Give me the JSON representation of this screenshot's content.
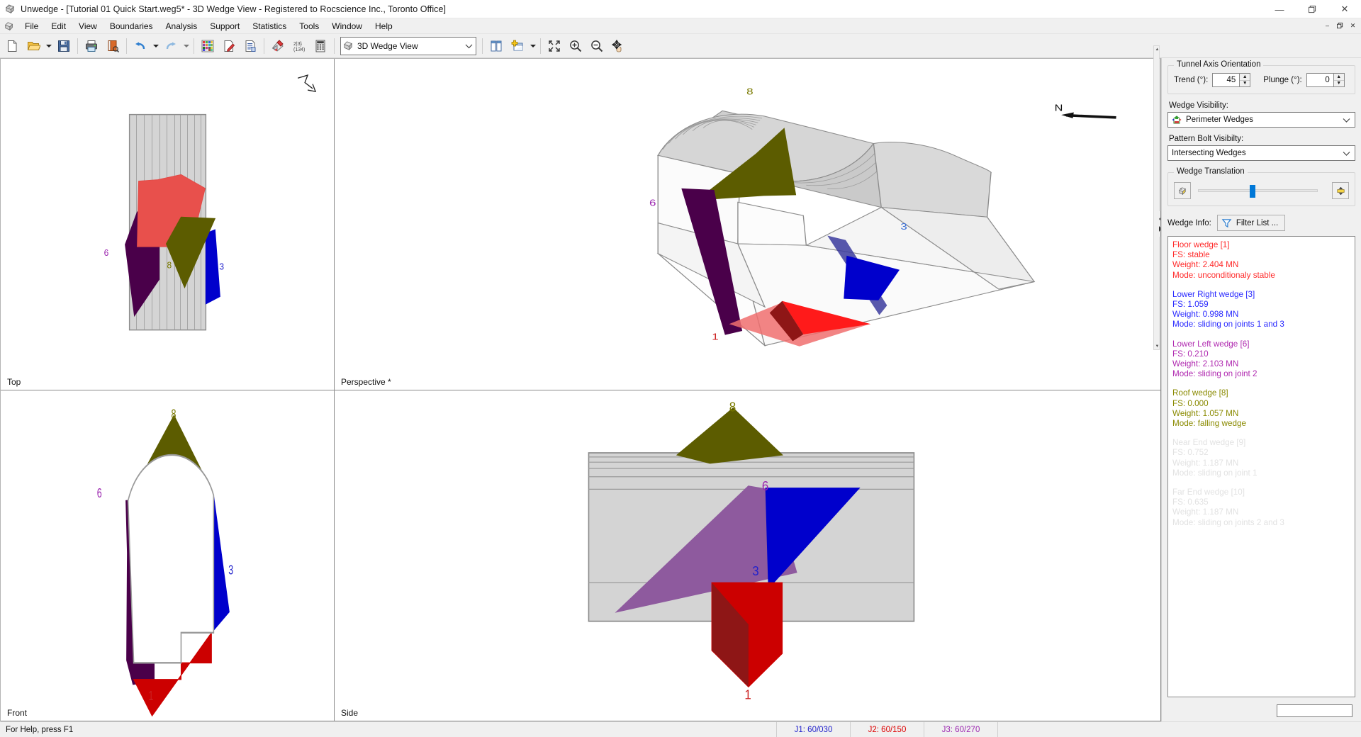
{
  "window": {
    "title": "Unwedge - [Tutorial 01 Quick Start.weg5* - 3D Wedge View - Registered to Rocscience Inc., Toronto Office]",
    "app_icon": "unwedge-icon",
    "minimize_label": "—",
    "maximize_label": "❐",
    "close_label": "✕",
    "mdi_restore_label": "–",
    "mdi_maximize_label": "❐",
    "mdi_close_label": "✕"
  },
  "menubar": {
    "icon": "document-icon",
    "items": [
      {
        "label": "File"
      },
      {
        "label": "Edit"
      },
      {
        "label": "View"
      },
      {
        "label": "Boundaries"
      },
      {
        "label": "Analysis"
      },
      {
        "label": "Support"
      },
      {
        "label": "Statistics"
      },
      {
        "label": "Tools"
      },
      {
        "label": "Window"
      },
      {
        "label": "Help"
      }
    ]
  },
  "toolbar": {
    "buttons": [
      {
        "name": "new-file-icon",
        "tip": "New"
      },
      {
        "name": "open-folder-icon",
        "tip": "Open"
      },
      {
        "name": "open-dropdown-arrow-icon",
        "tip": "Open recent"
      },
      {
        "name": "save-icon",
        "tip": "Save"
      },
      {
        "name": "print-icon",
        "tip": "Print"
      },
      {
        "name": "print-preview-icon",
        "tip": "Print Preview"
      },
      {
        "name": "undo-icon",
        "tip": "Undo"
      },
      {
        "name": "undo-dropdown-arrow-icon",
        "tip": "Undo history"
      },
      {
        "name": "redo-icon",
        "tip": "Redo"
      },
      {
        "name": "redo-dropdown-arrow-icon",
        "tip": "Redo history"
      },
      {
        "name": "color-palette-icon",
        "tip": "Display Options"
      },
      {
        "name": "page-pencil-icon",
        "tip": "Edit Properties"
      },
      {
        "name": "report-icon",
        "tip": "Info Viewer"
      },
      {
        "name": "joint-properties-icon",
        "tip": "Joint Properties"
      },
      {
        "name": "statistics-icon",
        "tip": "Statistics"
      },
      {
        "name": "grid-calculator-icon",
        "tip": "Compute"
      }
    ],
    "view_combo": {
      "value": "3D Wedge View",
      "icon": "wedge-view-icon",
      "caret": "∨"
    },
    "right_buttons": [
      {
        "name": "tile-vertical-icon",
        "tip": "Tile Vertically"
      },
      {
        "name": "add-view-icon",
        "tip": "Add View"
      },
      {
        "name": "add-view-dropdown-arrow-icon",
        "tip": "Add View menu"
      },
      {
        "name": "zoom-all-icon",
        "tip": "Zoom All"
      },
      {
        "name": "zoom-in-icon",
        "tip": "Zoom In"
      },
      {
        "name": "zoom-out-icon",
        "tip": "Zoom Out"
      },
      {
        "name": "pan-icon",
        "tip": "Pan"
      }
    ]
  },
  "viewports": [
    {
      "id": "top",
      "label": "Top",
      "compass_icon": "north-arrow-icon"
    },
    {
      "id": "perspective",
      "label": "Perspective *",
      "compass_icon": "north-arrow-icon",
      "compass_label": "N"
    },
    {
      "id": "front",
      "label": "Front"
    },
    {
      "id": "side",
      "label": "Side"
    }
  ],
  "wedge_labels": {
    "roof": "8",
    "lower_left": "6",
    "lower_right": "3",
    "floor": "1"
  },
  "sidepanel": {
    "tunnel_axis": {
      "title": "Tunnel Axis Orientation",
      "trend_label": "Trend (°):",
      "trend_value": "45",
      "plunge_label": "Plunge (°):",
      "plunge_value": "0",
      "spin_up": "▲",
      "spin_down": "▼"
    },
    "wedge_visibility": {
      "label": "Wedge Visibility:",
      "value": "Perimeter Wedges",
      "icon": "perimeter-wedges-icon",
      "caret": "∨"
    },
    "pattern_bolt_visibility": {
      "label": "Pattern Bolt Visibilty:",
      "value": "Intersecting Wedges",
      "caret": "∨"
    },
    "wedge_translation": {
      "title": "Wedge Translation",
      "reset_icon": "wedge-reset-icon",
      "scale_icon": "wedge-scale-icon",
      "slider_percent": 43
    },
    "wedge_info": {
      "label": "Wedge Info:",
      "filter_button": "Filter List ...",
      "filter_icon": "funnel-icon"
    }
  },
  "wedges": [
    {
      "name": "Floor wedge [1]",
      "fs": "FS: stable",
      "weight": "Weight: 2.404 MN",
      "mode": "Mode: unconditionaly stable",
      "color": "#ff0000",
      "dimmed": false
    },
    {
      "name": "Lower Right wedge [3]",
      "fs": "FS: 1.059",
      "weight": "Weight: 0.998 MN",
      "mode": "Mode: sliding on joints 1 and 3",
      "color": "#0000ff",
      "dimmed": false
    },
    {
      "name": "Lower Left wedge [6]",
      "fs": "FS: 0.210",
      "weight": "Weight: 2.103 MN",
      "mode": "Mode: sliding on joint 2",
      "color": "#9c27b0",
      "dimmed": false
    },
    {
      "name": "Roof wedge [8]",
      "fs": "FS: 0.000",
      "weight": "Weight: 1.057 MN",
      "mode": "Mode: falling wedge",
      "color": "#8a8a00",
      "dimmed": false
    },
    {
      "name": "Near End wedge [9]",
      "fs": "FS: 0.752",
      "weight": "Weight: 1.187 MN",
      "mode": "Mode: sliding on joint 1",
      "color": "#e0e0e0",
      "dimmed": true
    },
    {
      "name": "Far End wedge [10]",
      "fs": "FS: 0.635",
      "weight": "Weight: 1.187 MN",
      "mode": "Mode: sliding on joints 2 and 3",
      "color": "#e0e0e0",
      "dimmed": true
    }
  ],
  "statusbar": {
    "help_text": "For Help, press F1",
    "joints": [
      {
        "label": "J1: 60/030",
        "color": "#2222cc"
      },
      {
        "label": "J2: 60/150",
        "color": "#dd0000"
      },
      {
        "label": "J3: 60/270",
        "color": "#9c27b0"
      }
    ]
  },
  "colors": {
    "floor_wedge": "#cc0000",
    "floor_wedge_light": "#f06060",
    "lower_right_wedge": "#0000cc",
    "lower_left_wedge": "#4a004a",
    "lower_left_wedge_light": "#8e5a9e",
    "roof_wedge": "#5c5c00",
    "tunnel_gray": "#d4d4d4",
    "outline": "#808080"
  }
}
